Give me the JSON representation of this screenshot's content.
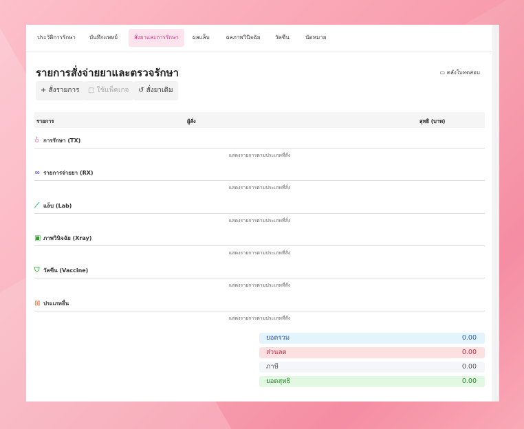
{
  "tabs": [
    "ประวัติการรักษา",
    "บันทึกแพทย์",
    "สั่งยาและการรักษา",
    "ผลแล็บ",
    "ผลภาพวินิจฉัย",
    "วัคซีน",
    "นัดหมาย"
  ],
  "title": "รายการสั่งจ่ายยาและตรวจรักษา",
  "archive_label": "คลังใบทดสอบ",
  "buttons": {
    "add": "สั่งรายการ",
    "package": "ใช้แพ็คเกจ",
    "reorder": "สั่งยาเดิม"
  },
  "columns": [
    "รายการ",
    "ผู้สั่ง",
    "สุทธิ (บาท)"
  ],
  "sections": [
    {
      "title": "การรักษา (TX)",
      "icon": "stethoscope-icon",
      "color": "#e879c6"
    },
    {
      "title": "รายการจ่ายยา (RX)",
      "icon": "pill-icon",
      "color": "#6b6bf0"
    },
    {
      "title": "แล็บ (Lab)",
      "icon": "test-tube-icon",
      "color": "#22c55e"
    },
    {
      "title": "ภาพวินิจฉัย (Xray)",
      "icon": "xray-icon",
      "color": "#3a9a3a"
    },
    {
      "title": "วัคซีน (Vaccine)",
      "icon": "shield-icon",
      "color": "#4caf50"
    },
    {
      "title": "ประเภทอื่น",
      "icon": "grid-icon",
      "color": "#f08050"
    }
  ],
  "hint": "แสดงรายการตามประเภทที่สั่ง",
  "totals": [
    {
      "label": "ยอดรวม",
      "value": "0.00",
      "bg": "#e3f4fd",
      "color": "#2a5ca8"
    },
    {
      "label": "ส่วนลด",
      "value": "0.00",
      "bg": "#fde0e2",
      "color": "#c8283c"
    },
    {
      "label": "ภาษี",
      "value": "0.00",
      "bg": "#f5f6fa",
      "color": "#555"
    },
    {
      "label": "ยอดสุทธิ",
      "value": "0.00",
      "bg": "#e3f8e3",
      "color": "#2a8a2a"
    }
  ]
}
